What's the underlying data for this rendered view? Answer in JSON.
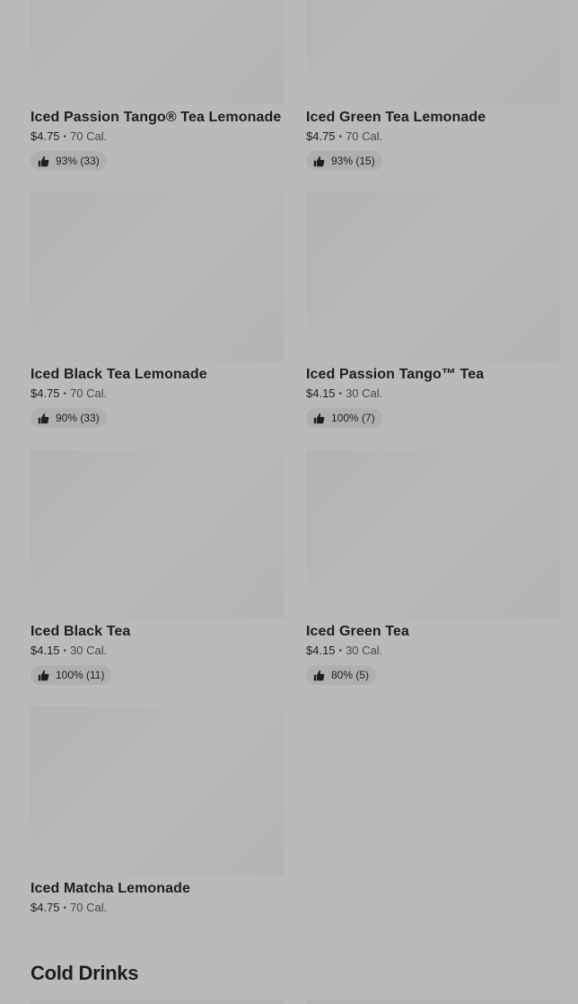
{
  "products": [
    {
      "name": "Iced Passion Tango® Tea Lemonade",
      "price": "$4.75",
      "separator": "•",
      "calories": "70 Cal.",
      "rating": "93% (33)"
    },
    {
      "name": "Iced Green Tea Lemonade",
      "price": "$4.75",
      "separator": "•",
      "calories": "70 Cal.",
      "rating": "93% (15)"
    },
    {
      "name": "Iced Black Tea Lemonade",
      "price": "$4.75",
      "separator": "•",
      "calories": "70 Cal.",
      "rating": "90% (33)"
    },
    {
      "name": "Iced Passion Tango™ Tea",
      "price": "$4.15",
      "separator": "•",
      "calories": "30 Cal.",
      "rating": "100% (7)"
    },
    {
      "name": "Iced Black Tea",
      "price": "$4.15",
      "separator": "•",
      "calories": "30 Cal.",
      "rating": "100% (11)"
    },
    {
      "name": "Iced Green Tea",
      "price": "$4.15",
      "separator": "•",
      "calories": "30 Cal.",
      "rating": "80% (5)"
    },
    {
      "name": "Iced Matcha Lemonade",
      "price": "$4.75",
      "separator": "•",
      "calories": "70 Cal.",
      "rating": null
    }
  ],
  "next_section": {
    "title": "Cold Drinks"
  },
  "icons": {
    "rating": "thumbs-up-icon"
  },
  "colors": {
    "background": "#bababa",
    "image_placeholder": "#b5b5b5",
    "rating_pill": "#afafaf",
    "text": "#1e1e1e"
  }
}
